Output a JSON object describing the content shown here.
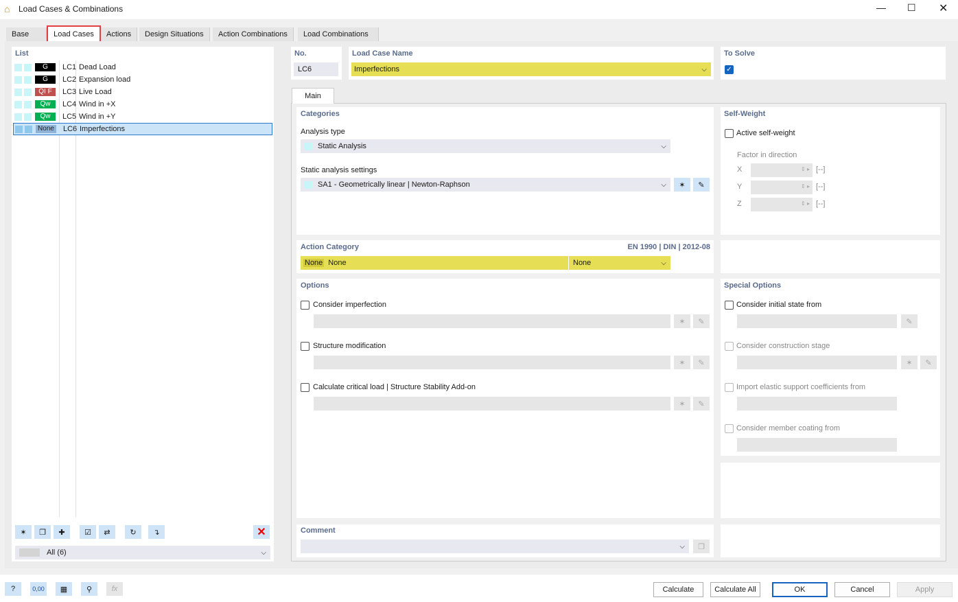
{
  "window": {
    "title": "Load Cases & Combinations"
  },
  "tabs": [
    "Base",
    "Load Cases",
    "Actions",
    "Design Situations",
    "Action Combinations",
    "Load Combinations"
  ],
  "list": {
    "header": "List",
    "items": [
      {
        "badge": "G",
        "badge_color": "#000000",
        "no": "LC1",
        "name": "Dead Load"
      },
      {
        "badge": "G",
        "badge_color": "#000000",
        "no": "LC2",
        "name": "Expansion load"
      },
      {
        "badge": "QI F",
        "badge_color": "#c0504d",
        "no": "LC3",
        "name": "Live Load"
      },
      {
        "badge": "Qw",
        "badge_color": "#00b050",
        "no": "LC4",
        "name": "Wind in +X"
      },
      {
        "badge": "Qw",
        "badge_color": "#00b050",
        "no": "LC5",
        "name": "Wind in +Y"
      },
      {
        "badge": "None",
        "badge_color": "#8fb4d8",
        "no": "LC6",
        "name": "Imperfections",
        "selected": true
      }
    ],
    "filter": "All (6)"
  },
  "header": {
    "no_label": "No.",
    "no_value": "LC6",
    "name_label": "Load Case Name",
    "name_value": "Imperfections",
    "to_solve_label": "To Solve",
    "to_solve": true
  },
  "main_tab": "Main",
  "categories": {
    "title": "Categories",
    "analysis_type_label": "Analysis type",
    "analysis_type": "Static Analysis",
    "settings_label": "Static analysis settings",
    "settings": "SA1 - Geometrically linear | Newton-Raphson"
  },
  "self_weight": {
    "title": "Self-Weight",
    "active_label": "Active self-weight",
    "factor_label": "Factor in direction",
    "axes": [
      "X",
      "Y",
      "Z"
    ],
    "unit": "[--]"
  },
  "action_category": {
    "title": "Action Category",
    "standard": "EN 1990 | DIN | 2012-08",
    "code": "None",
    "name": "None",
    "value2": "None"
  },
  "options": {
    "title": "Options",
    "items": [
      "Consider imperfection",
      "Structure modification",
      "Calculate critical load | Structure Stability Add-on"
    ]
  },
  "special_options": {
    "title": "Special Options",
    "items": [
      "Consider initial state from",
      "Consider construction stage",
      "Import elastic support coefficients from",
      "Consider member coating from"
    ]
  },
  "comment": {
    "title": "Comment"
  },
  "buttons": {
    "calculate": "Calculate",
    "calculate_all": "Calculate All",
    "ok": "OK",
    "cancel": "Cancel",
    "apply": "Apply"
  },
  "bottom_icons": {
    "b2": "0,00"
  }
}
